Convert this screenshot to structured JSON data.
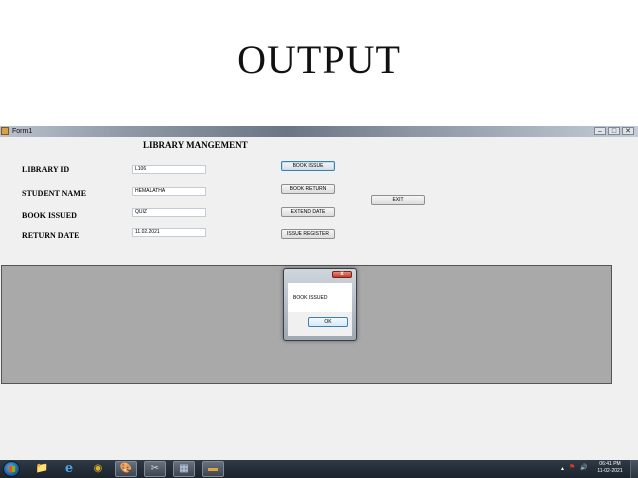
{
  "slide": {
    "title": "OUTPUT"
  },
  "window": {
    "title": "Form1",
    "controls": {
      "minimize": "–",
      "maximize": "□",
      "close": "✕"
    }
  },
  "form": {
    "heading": "LIBRARY MANGEMENT",
    "fields": {
      "library_id": {
        "label": "LIBRARY ID",
        "value": "L106"
      },
      "student_name": {
        "label": "STUDENT NAME",
        "value": "HEMALATHA"
      },
      "book_issued": {
        "label": "BOOK ISSUED",
        "value": "QUIZ"
      },
      "return_date": {
        "label": "RETURN DATE",
        "value": "11.02.2021"
      }
    },
    "buttons": {
      "book_issue": "BOOK ISSUE",
      "book_return": "BOOK RETURN",
      "extend_date": "EXTEND DATE",
      "issue_register": "ISSUE REGISTER",
      "exit": "EXIT"
    }
  },
  "dialog": {
    "close": "x",
    "message": "BOOK ISSUED",
    "ok": "OK"
  },
  "taskbar": {
    "items": [
      {
        "icon": "folder-icon",
        "glyph": "📁"
      },
      {
        "icon": "internet-explorer-icon",
        "glyph": "e"
      },
      {
        "icon": "chrome-icon",
        "glyph": "◉"
      },
      {
        "icon": "paint-icon",
        "glyph": "🎨"
      },
      {
        "icon": "tools-icon",
        "glyph": "✂"
      },
      {
        "icon": "visual-studio-icon",
        "glyph": "▦"
      },
      {
        "icon": "form-app-icon",
        "glyph": "▬"
      }
    ],
    "tray": {
      "arrow": "▲",
      "flag": "⚑",
      "volume": "🔊"
    },
    "clock": {
      "time": "06:41 PM",
      "date": "11-02-2021"
    }
  }
}
